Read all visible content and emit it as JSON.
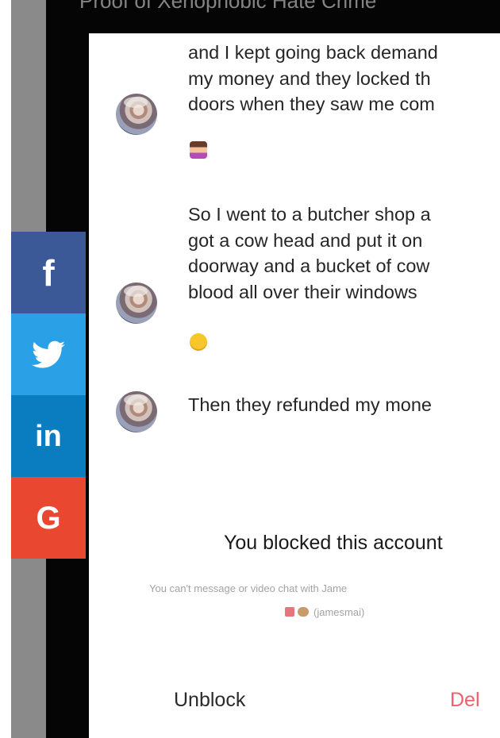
{
  "header": {
    "title": "Proof of Xenophobic Hate Crime"
  },
  "colors": {
    "facebook": "#3b5897",
    "twitter": "#2aa0e6",
    "linkedin": "#0a7cc0",
    "google": "#ea4731",
    "delete_accent": "#ed5f6a"
  },
  "share": {
    "facebook_icon": "f",
    "linkedin_icon": "in",
    "google_icon": "G"
  },
  "messages": [
    {
      "lines": [
        "and I kept going back demand",
        "my money and they locked th",
        "doors when they saw me com"
      ]
    },
    {
      "lines": [
        "So I went to a butcher shop a",
        "got a cow head and put it on",
        "doorway and a bucket of cow",
        "blood all over their windows"
      ]
    },
    {
      "lines": [
        "Then they refunded my mone"
      ]
    }
  ],
  "blocked": {
    "title": "You blocked this account",
    "subtitle": "You can't message or video chat with Jame",
    "handle": "(jamesmai)"
  },
  "actions": {
    "unblock_label": "Unblock",
    "delete_label": "Del"
  }
}
